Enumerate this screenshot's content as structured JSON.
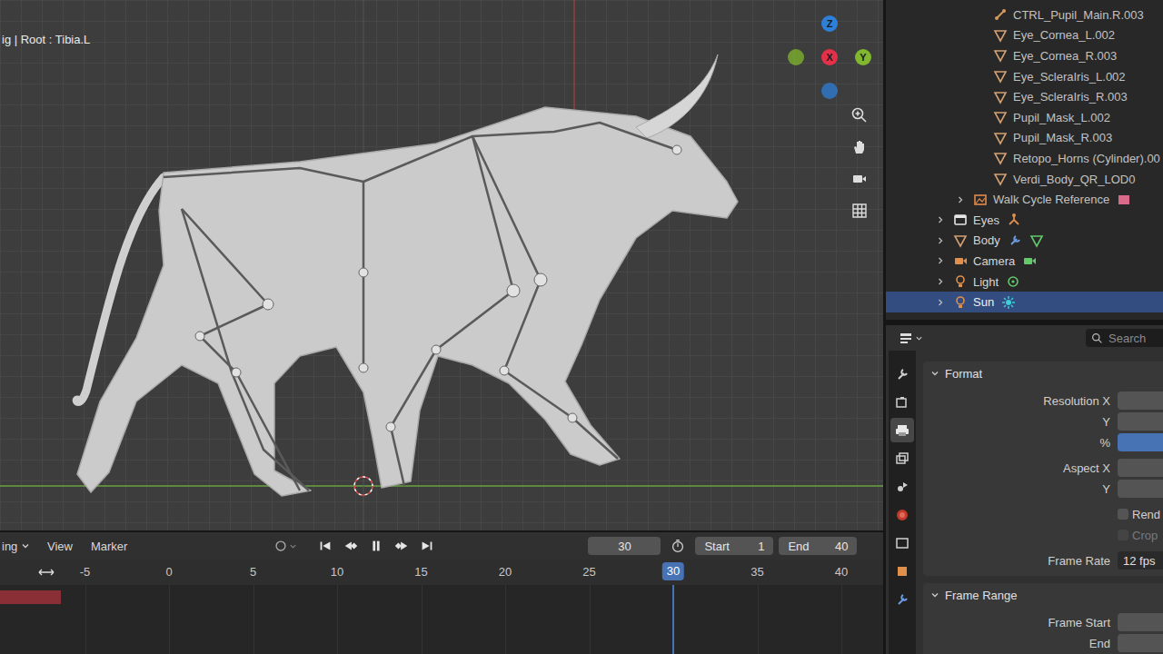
{
  "viewport": {
    "header": "ig | Root : Tibia.L",
    "gizmo": [
      {
        "label": "Z",
        "color": "#2e7fd8"
      },
      {
        "label": "X",
        "color": "#e5304a"
      },
      {
        "label": "Y",
        "color": "#80b72e"
      }
    ]
  },
  "outliner": {
    "items": [
      {
        "label": "CTRL_Pupil_Main.R.003",
        "kind": "bone",
        "depth": 2,
        "expandable": false,
        "selected": false
      },
      {
        "label": "Eye_Cornea_L.002",
        "kind": "mesh",
        "depth": 2,
        "expandable": false,
        "selected": false
      },
      {
        "label": "Eye_Cornea_R.003",
        "kind": "mesh",
        "depth": 2,
        "expandable": false,
        "selected": false
      },
      {
        "label": "Eye_ScleraIris_L.002",
        "kind": "mesh",
        "depth": 2,
        "expandable": false,
        "selected": false
      },
      {
        "label": "Eye_ScleraIris_R.003",
        "kind": "mesh",
        "depth": 2,
        "expandable": false,
        "selected": false
      },
      {
        "label": "Pupil_Mask_L.002",
        "kind": "mesh",
        "depth": 2,
        "expandable": false,
        "selected": false
      },
      {
        "label": "Pupil_Mask_R.003",
        "kind": "mesh",
        "depth": 2,
        "expandable": false,
        "selected": false
      },
      {
        "label": "Retopo_Horns (Cylinder).00",
        "kind": "mesh",
        "depth": 2,
        "expandable": false,
        "selected": false
      },
      {
        "label": "Verdi_Body_QR_LOD0",
        "kind": "mesh",
        "depth": 2,
        "expandable": false,
        "selected": false
      },
      {
        "label": "Walk Cycle Reference",
        "kind": "image",
        "depth": 1,
        "expandable": true,
        "selected": false
      },
      {
        "label": "Eyes",
        "kind": "eyes",
        "depth": 0,
        "expandable": true,
        "selected": false
      },
      {
        "label": "Body",
        "kind": "body",
        "depth": 0,
        "expandable": true,
        "selected": false
      },
      {
        "label": "Camera",
        "kind": "camera",
        "depth": 0,
        "expandable": true,
        "selected": false
      },
      {
        "label": "Light",
        "kind": "light",
        "depth": 0,
        "expandable": true,
        "selected": false
      },
      {
        "label": "Sun",
        "kind": "sun",
        "depth": 0,
        "expandable": true,
        "selected": true
      }
    ]
  },
  "timeline": {
    "mode": "ing",
    "menus": [
      "View",
      "Marker"
    ],
    "playing": true,
    "current_frame": "30",
    "start_label": "Start",
    "start": "1",
    "end_label": "End",
    "end": "40",
    "ticks": [
      "-5",
      "0",
      "5",
      "10",
      "15",
      "20",
      "25",
      "30",
      "35",
      "40"
    ]
  },
  "properties": {
    "search_placeholder": "Search",
    "tabs": [
      {
        "kind": "tool",
        "selected": false
      },
      {
        "kind": "render",
        "selected": false
      },
      {
        "kind": "output",
        "selected": true
      },
      {
        "kind": "view_layer",
        "selected": false
      },
      {
        "kind": "scene",
        "selected": false
      },
      {
        "kind": "world",
        "selected": false
      },
      {
        "kind": "collection",
        "selected": false
      },
      {
        "kind": "object",
        "selected": false
      },
      {
        "kind": "modifier",
        "selected": false
      }
    ],
    "panels": [
      {
        "title": "Format",
        "expanded": true,
        "groups": [
          [
            {
              "label": "Resolution X",
              "kind": "field"
            },
            {
              "label": "Y",
              "kind": "field"
            },
            {
              "label": "%",
              "kind": "slider",
              "level": 1
            }
          ],
          [
            {
              "label": "Aspect X",
              "kind": "field"
            },
            {
              "label": "Y",
              "kind": "field"
            }
          ],
          [
            {
              "label": "Rend",
              "kind": "checkbox",
              "checked": false,
              "disabled": false
            },
            {
              "label": "Crop",
              "kind": "checkbox",
              "checked": false,
              "disabled": true
            }
          ],
          [
            {
              "label": "Frame Rate",
              "kind": "dropdown",
              "value": "12 fps"
            }
          ]
        ]
      },
      {
        "title": "Frame Range",
        "expanded": true,
        "groups": [
          [
            {
              "label": "Frame Start",
              "kind": "field"
            },
            {
              "label": "End",
              "kind": "field"
            }
          ]
        ]
      }
    ]
  }
}
